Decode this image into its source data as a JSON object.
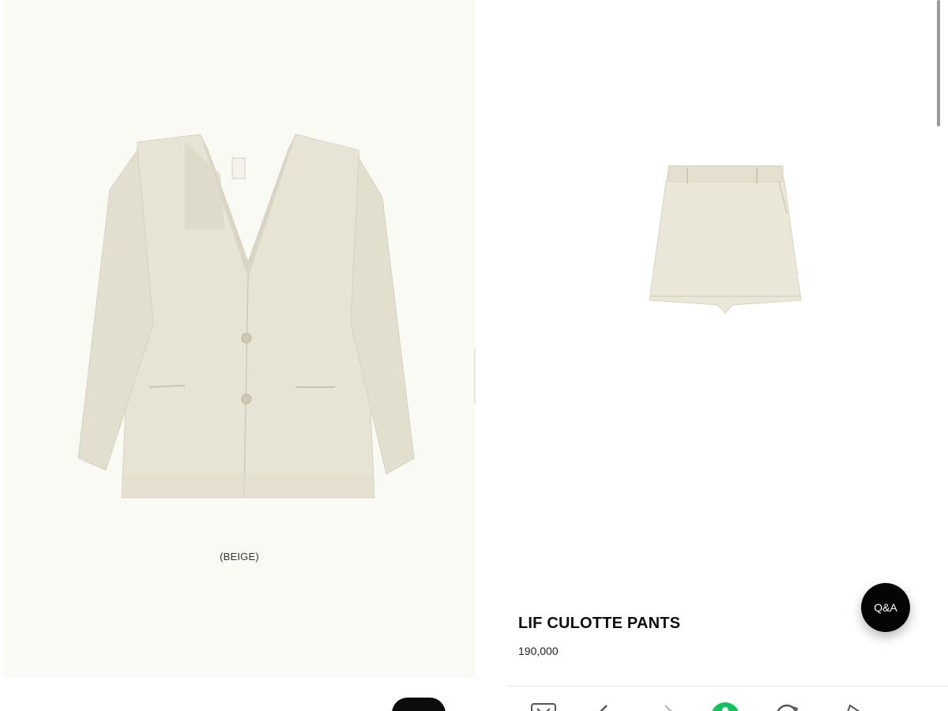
{
  "left_panel": {
    "color_caption": "(BEIGE)",
    "jacket_color": "#e7e3d3"
  },
  "product": {
    "title": "LIF CULOTTE PANTS",
    "price": "190,000",
    "skort_color": "#e8e3d2"
  },
  "qa_button": {
    "label": "Q&A"
  },
  "toolbar": {
    "icons": [
      "tabs-icon",
      "back-arrow-icon",
      "forward-arrow-icon",
      "home-icon",
      "refresh-icon",
      "share-icon"
    ],
    "accent": "#12c25c"
  }
}
